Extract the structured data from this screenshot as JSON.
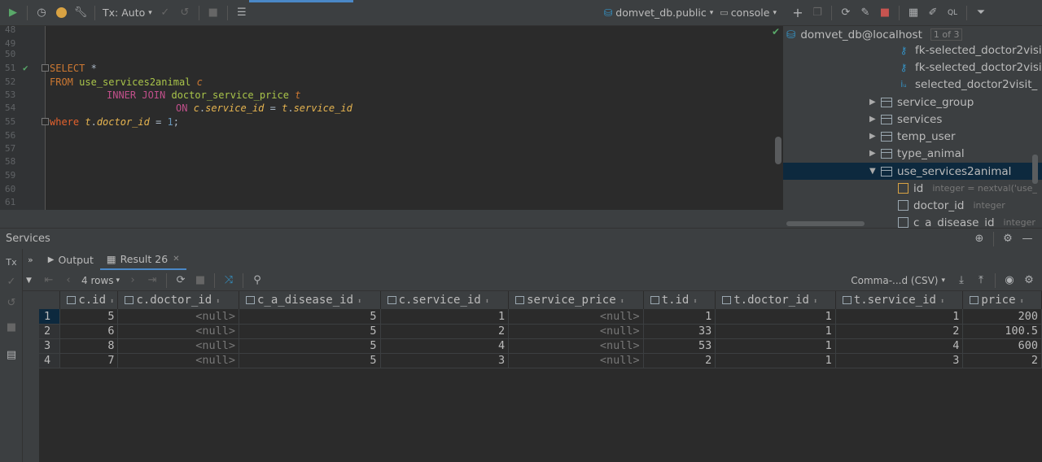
{
  "toolbar": {
    "tx_mode": "Tx: Auto",
    "schema": "domvet_db.public",
    "console": "console"
  },
  "editor": {
    "line_numbers": [
      "48",
      "49",
      "50",
      "51",
      "52",
      "53",
      "54",
      "55",
      "56",
      "57",
      "58",
      "59",
      "60",
      "61"
    ],
    "code": {
      "select_kw": "SELECT",
      "star": " *",
      "from_kw": "FROM",
      "from_table": "use_services2animal",
      "from_alias": "c",
      "inner_join_kw": "INNER JOIN",
      "join_table": "doctor_service_price",
      "join_alias": "t",
      "on_kw": "ON",
      "on_left_alias": "c",
      "on_left_col": "service_id",
      "on_eq": " = ",
      "on_right_alias": "t",
      "on_right_col": "service_id",
      "where_kw": "where",
      "where_alias": "t",
      "where_col": "doctor_id",
      "where_eq": " = ",
      "where_val": "1",
      "semicolon": ";"
    }
  },
  "tree": {
    "host": "domvet_db@localhost",
    "host_badge": "1 of 3",
    "keys": [
      {
        "label": "fk-selected_doctor2visi"
      },
      {
        "label": "fk-selected_doctor2visi"
      },
      {
        "label": "selected_doctor2visit_"
      }
    ],
    "tables": [
      {
        "label": "service_group"
      },
      {
        "label": "services"
      },
      {
        "label": "temp_user"
      },
      {
        "label": "type_animal"
      },
      {
        "label": "use_services2animal"
      }
    ],
    "columns": [
      {
        "label": "id",
        "hint": "integer = nextval('use_"
      },
      {
        "label": "doctor_id",
        "hint": "integer"
      },
      {
        "label": "c_a_disease_id",
        "hint": "integer"
      }
    ]
  },
  "services": {
    "title": "Services",
    "tabs": {
      "output": "Output",
      "result": "Result 26"
    },
    "rows_label": "4 rows",
    "export_format": "Comma-...d (CSV)"
  },
  "grid": {
    "columns": [
      "c.id",
      "c.doctor_id",
      "c_a_disease_id",
      "c.service_id",
      "service_price",
      "t.id",
      "t.doctor_id",
      "t.service_id",
      "price"
    ],
    "rows": [
      {
        "n": "1",
        "cells": [
          "5",
          "<null>",
          "5",
          "1",
          "<null>",
          "1",
          "1",
          "1",
          "200"
        ]
      },
      {
        "n": "2",
        "cells": [
          "6",
          "<null>",
          "5",
          "2",
          "<null>",
          "33",
          "1",
          "2",
          "100.5"
        ]
      },
      {
        "n": "3",
        "cells": [
          "8",
          "<null>",
          "5",
          "4",
          "<null>",
          "53",
          "1",
          "4",
          "600"
        ]
      },
      {
        "n": "4",
        "cells": [
          "7",
          "<null>",
          "5",
          "3",
          "<null>",
          "2",
          "1",
          "3",
          "2"
        ]
      }
    ]
  },
  "colors": {
    "keyword": "#cc7832",
    "table": "#a9c44a",
    "number": "#6897bb",
    "selection": "#0d293e",
    "accent": "#4a88c7"
  }
}
